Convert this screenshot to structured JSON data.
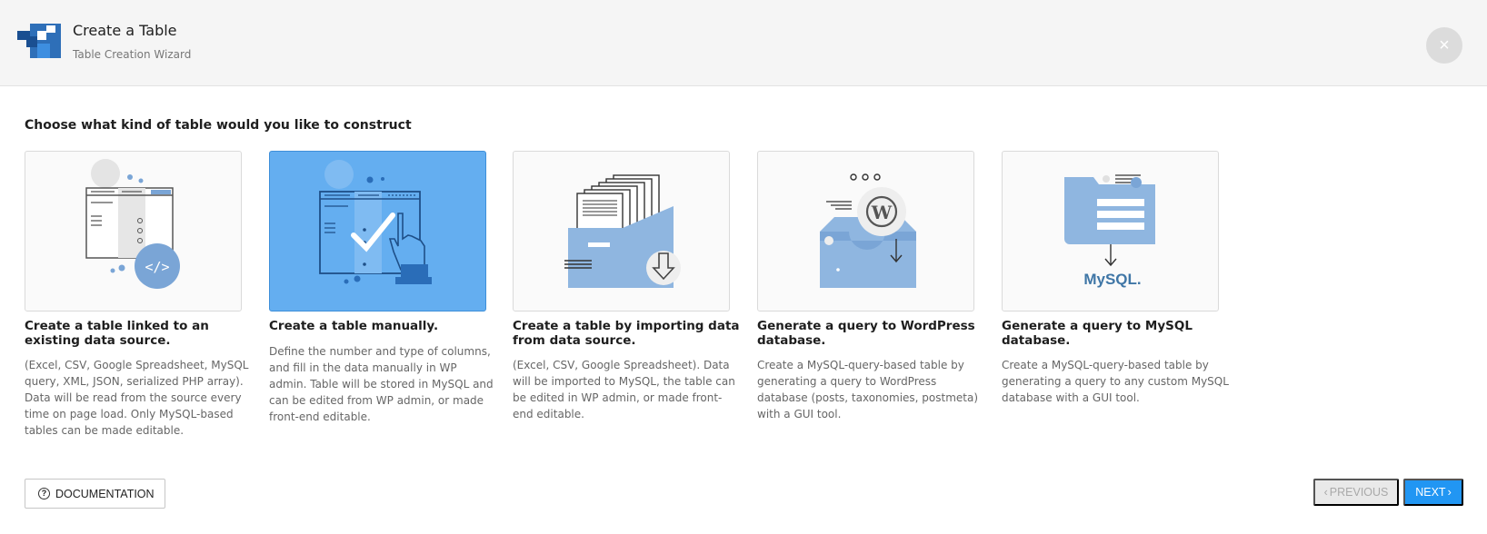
{
  "header": {
    "title": "Create a Table",
    "subtitle": "Table Creation Wizard",
    "close_label": "×"
  },
  "prompt": "Choose what kind of table would you like to construct",
  "cards": [
    {
      "title": "Create a table linked to an existing data source.",
      "description": "(Excel, CSV, Google Spreadsheet, MySQL query, XML, JSON, serialized PHP array). Data will be read from the source every time on page load. Only MySQL-based tables can be made editable.",
      "selected": false
    },
    {
      "title": "Create a table manually.",
      "description": "Define the number and type of columns, and fill in the data manually in WP admin. Table will be stored in MySQL and can be edited from WP admin, or made front-end editable.",
      "selected": true
    },
    {
      "title": "Create a table by importing data from data source.",
      "description": "(Excel, CSV, Google Spreadsheet). Data will be imported to MySQL, the table can be edited in WP admin, or made front-end editable.",
      "selected": false
    },
    {
      "title": "Generate a query to WordPress database.",
      "description": "Create a MySQL-query-based table by generating a query to WordPress database (posts, taxonomies, postmeta) with a GUI tool.",
      "selected": false
    },
    {
      "title": "Generate a query to MySQL database.",
      "description": "Create a MySQL-query-based table by generating a query to any custom MySQL database with a GUI tool.",
      "selected": false
    }
  ],
  "mysql_logo_text": "MySQL.",
  "code_icon_text": "</>",
  "footer": {
    "documentation_label": "DOCUMENTATION",
    "help_icon_glyph": "?",
    "previous_label": "PREVIOUS",
    "next_label": "NEXT"
  },
  "colors": {
    "accent": "#2196f3",
    "selected_card": "#64aef0",
    "illustration_blue": "#8fb6e0"
  }
}
